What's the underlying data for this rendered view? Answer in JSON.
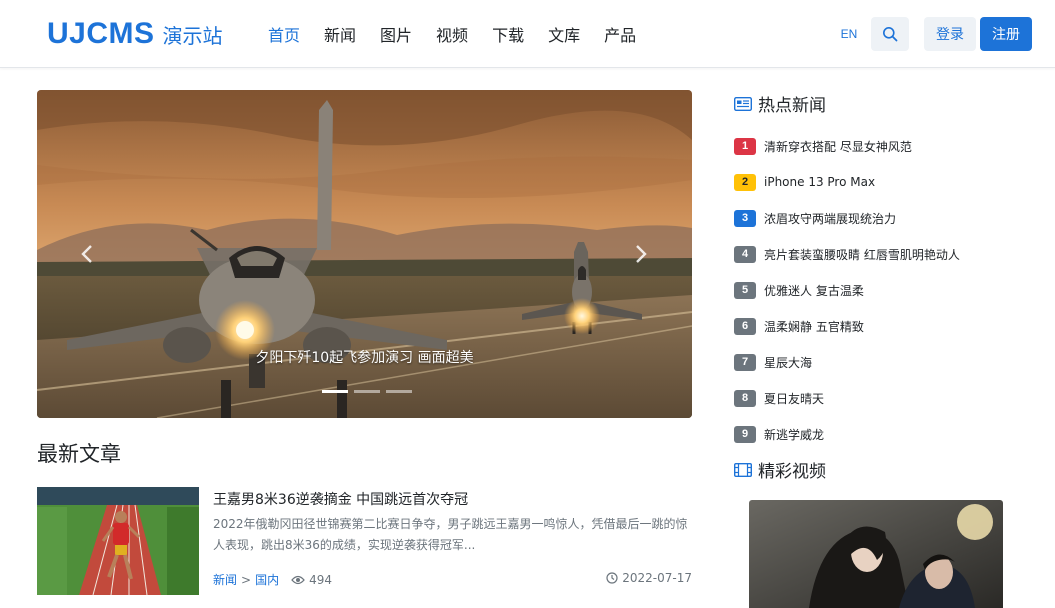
{
  "header": {
    "logo_text": "UJCMS",
    "logo_sub": "演示站",
    "nav": [
      {
        "label": "首页",
        "active": true
      },
      {
        "label": "新闻",
        "active": false
      },
      {
        "label": "图片",
        "active": false
      },
      {
        "label": "视频",
        "active": false
      },
      {
        "label": "下载",
        "active": false
      },
      {
        "label": "文库",
        "active": false
      },
      {
        "label": "产品",
        "active": false
      }
    ],
    "lang_label": "EN",
    "search_icon": "search-icon",
    "login_label": "登录",
    "register_label": "注册"
  },
  "carousel": {
    "caption": "夕阳下歼10起飞参加演习 画面超美",
    "slide_count": 3,
    "active_index": 0,
    "prev_icon": "chevron-left-icon",
    "next_icon": "chevron-right-icon"
  },
  "latest": {
    "title": "最新文章",
    "articles": [
      {
        "title": "王嘉男8米36逆袭摘金 中国跳远首次夺冠",
        "desc": "2022年俄勒冈田径世锦赛第二比赛日争夺，男子跳远王嘉男一鸣惊人，凭借最后一跳的惊人表现，跳出8米36的成绩，实现逆袭获得冠军...",
        "category": "新闻",
        "subcategory": "国内",
        "separator": ">",
        "views": "494",
        "date": "2022-07-17"
      }
    ]
  },
  "sidebar": {
    "hot_title": "热点新闻",
    "hot_icon": "newspaper-icon",
    "hot_items": [
      {
        "rank": "1",
        "title": "清新穿衣搭配 尽显女神风范",
        "color": "#dc3545"
      },
      {
        "rank": "2",
        "title": "iPhone 13 Pro Max",
        "color": "#ffc107"
      },
      {
        "rank": "3",
        "title": "浓眉攻守两端展现统治力",
        "color": "#1d73d8"
      },
      {
        "rank": "4",
        "title": "亮片套装蛮腰吸睛 红唇雪肌明艳动人",
        "color": "#6c757d"
      },
      {
        "rank": "5",
        "title": "优雅迷人 复古温柔",
        "color": "#6c757d"
      },
      {
        "rank": "6",
        "title": "温柔娴静 五官精致",
        "color": "#6c757d"
      },
      {
        "rank": "7",
        "title": "星辰大海",
        "color": "#6c757d"
      },
      {
        "rank": "8",
        "title": "夏日友晴天",
        "color": "#6c757d"
      },
      {
        "rank": "9",
        "title": "新逃学威龙",
        "color": "#6c757d"
      }
    ],
    "video_title": "精彩视频",
    "video_icon": "film-icon"
  },
  "colors": {
    "brand": "#1d73d8",
    "muted": "#6c757d",
    "rank_1": "#dc3545",
    "rank_2": "#ffc107",
    "rank_3": "#1d73d8"
  }
}
